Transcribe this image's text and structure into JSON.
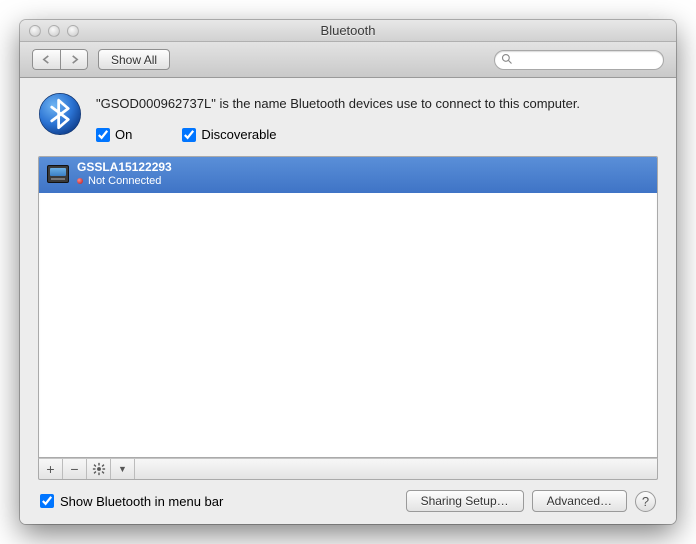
{
  "window": {
    "title": "Bluetooth"
  },
  "toolbar": {
    "showall_label": "Show All",
    "search_placeholder": ""
  },
  "header": {
    "info_prefix": "\"",
    "computer_name": "GSOD000962737L",
    "info_suffix": "\" is the name Bluetooth devices use to connect to this computer.",
    "on_label": "On",
    "on_checked": true,
    "discoverable_label": "Discoverable",
    "discoverable_checked": true
  },
  "devices": [
    {
      "name": "GSSLA15122293",
      "status": "Not Connected"
    }
  ],
  "list_toolbar": {
    "add": "+",
    "remove": "−"
  },
  "footer": {
    "menubar_label": "Show Bluetooth in menu bar",
    "menubar_checked": true,
    "sharing_label": "Sharing Setup…",
    "advanced_label": "Advanced…",
    "help_label": "?"
  }
}
